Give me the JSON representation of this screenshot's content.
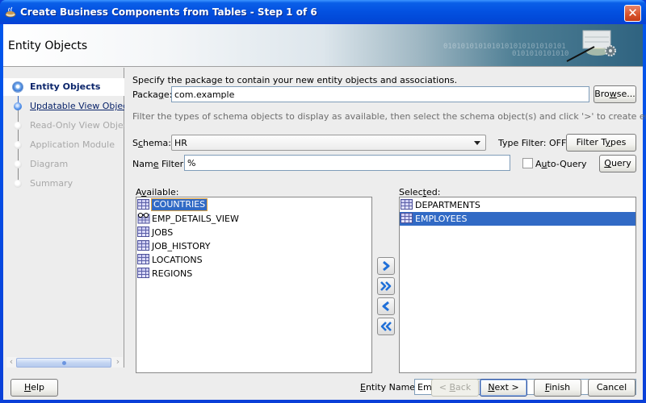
{
  "window": {
    "title": "Create Business Components from Tables - Step 1 of 6",
    "close_label": "✕"
  },
  "header": {
    "title": "Entity Objects",
    "binary_text_1": "0101010101010101010101010101",
    "binary_text_2": "0101010101010"
  },
  "sidebar": {
    "steps": [
      {
        "label": "Entity Objects",
        "state": "current"
      },
      {
        "label": "Updatable View Objects",
        "state": "visited"
      },
      {
        "label": "Read-Only View Objects",
        "state": "todo"
      },
      {
        "label": "Application Module",
        "state": "todo"
      },
      {
        "label": "Diagram",
        "state": "todo"
      },
      {
        "label": "Summary",
        "state": "todo"
      }
    ],
    "scroll_left": "‹",
    "scroll_right": "›"
  },
  "content": {
    "package_instruction": "Specify the package to contain your new entity objects and associations.",
    "package_label_pre": "Packa",
    "package_label_mnemonic": "g",
    "package_label_post": "e:",
    "package_value": "com.example",
    "browse_pre": "Bro",
    "browse_mnemonic": "w",
    "browse_post": "se...",
    "filter_instruction": "Filter the types of schema objects to display as available, then select the schema object(s) and click '>' to create entity objects.",
    "schema_label_pre": "S",
    "schema_label_mnemonic": "c",
    "schema_label_post": "hema:",
    "schema_value": "HR",
    "type_filter_status": "Type Filter: OFF",
    "filter_types_pre": "Filter T",
    "filter_types_mnemonic": "y",
    "filter_types_post": "pes",
    "name_filter_pre": "Nam",
    "name_filter_mnemonic": "e",
    "name_filter_post": " Filter:",
    "name_filter_value": "%",
    "auto_query_pre": "A",
    "auto_query_mnemonic": "u",
    "auto_query_post": "to-Query",
    "auto_query_checked": false,
    "query_mnemonic": "Q",
    "query_post": "uery",
    "available_pre": "A",
    "available_mnemonic": "v",
    "available_post": "ailable:",
    "available_items": [
      {
        "label": "COUNTRIES",
        "type": "table",
        "selected": true
      },
      {
        "label": "EMP_DETAILS_VIEW",
        "type": "view",
        "selected": false
      },
      {
        "label": "JOBS",
        "type": "table",
        "selected": false
      },
      {
        "label": "JOB_HISTORY",
        "type": "table",
        "selected": false
      },
      {
        "label": "LOCATIONS",
        "type": "table",
        "selected": false
      },
      {
        "label": "REGIONS",
        "type": "table",
        "selected": false
      }
    ],
    "selected_pre": "Selec",
    "selected_mnemonic": "t",
    "selected_post": "ed:",
    "selected_items": [
      {
        "label": "DEPARTMENTS",
        "type": "table",
        "selected": false
      },
      {
        "label": "EMPLOYEES",
        "type": "table",
        "selected": true
      }
    ],
    "entity_name_mnemonic": "E",
    "entity_name_post": "ntity Name:",
    "entity_name_value": "Employees"
  },
  "footer": {
    "help_mnemonic": "H",
    "help_post": "elp",
    "back_pre": "< ",
    "back_mnemonic": "B",
    "back_post": "ack",
    "next_mnemonic": "N",
    "next_post": "ext >",
    "finish_mnemonic": "F",
    "finish_post": "inish",
    "cancel_label": "Cancel"
  },
  "colors": {
    "titlebar": "#0350e0",
    "selection": "#316ac5",
    "focus_outline": "#e0a23c",
    "link": "#0a246a"
  }
}
